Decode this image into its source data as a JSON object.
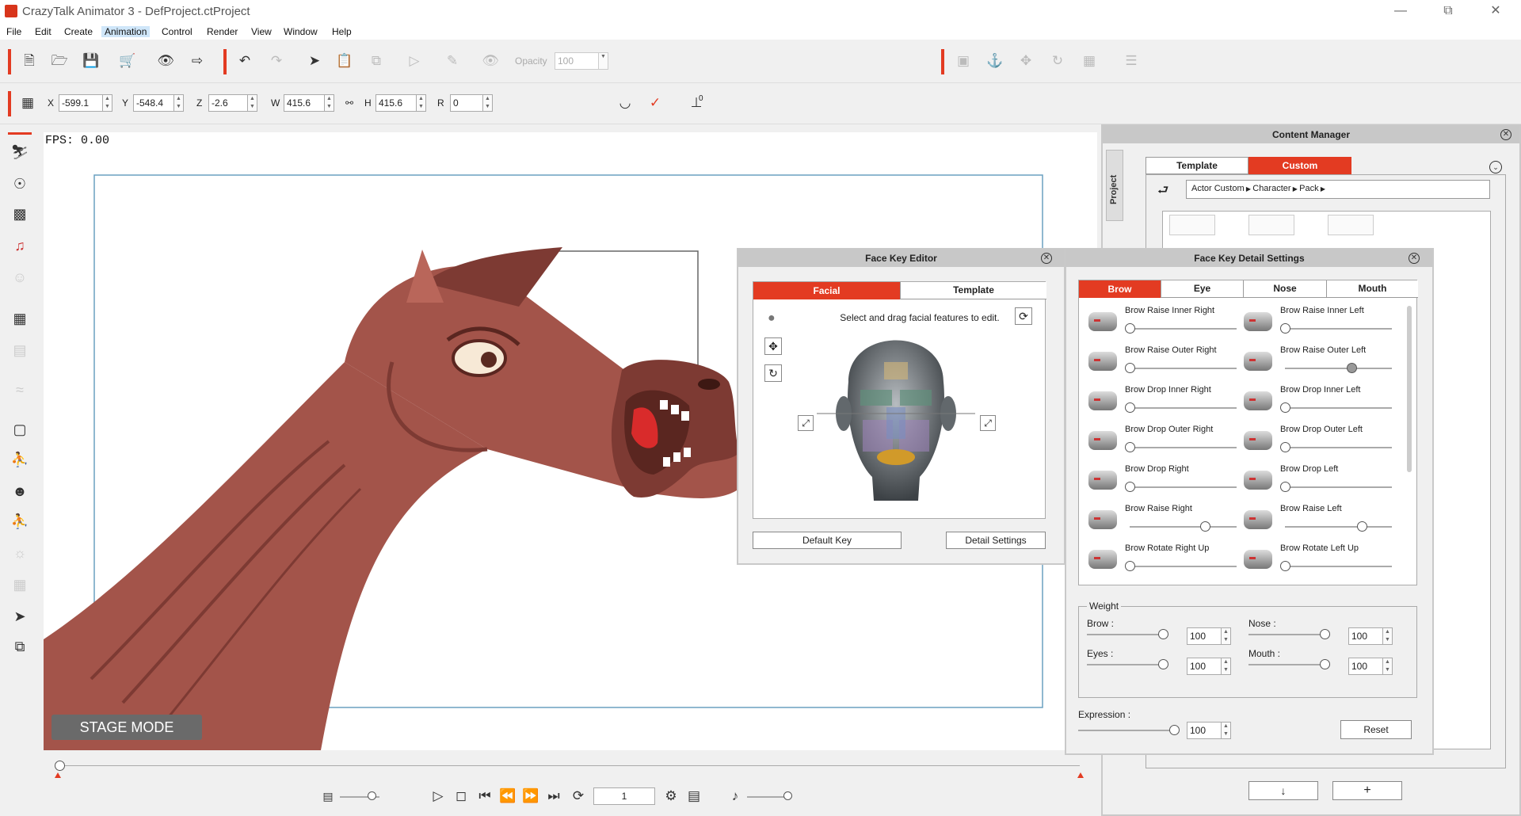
{
  "window": {
    "title": "CrazyTalk Animator 3   -  DefProject.ctProject",
    "minimize": "—",
    "maximize": "⧉",
    "close": "✕"
  },
  "menu": [
    "File",
    "Edit",
    "Create",
    "Animation",
    "Control",
    "Render",
    "View",
    "Window",
    "Help"
  ],
  "toolbar": {
    "opacity_label": "Opacity",
    "opacity_value": "100"
  },
  "transform": {
    "x_label": "X",
    "x": "-599.1",
    "y_label": "Y",
    "y": "-548.4",
    "z_label": "Z",
    "z": "-2.6",
    "w_label": "W",
    "w": "415.6",
    "h_label": "H",
    "h": "415.6",
    "r_label": "R",
    "r": "0",
    "pivot_value": "0"
  },
  "stage": {
    "fps": "FPS: 0.00",
    "mode_badge": "STAGE MODE"
  },
  "timeline": {
    "frame": "1"
  },
  "content_manager": {
    "title": "Content Manager",
    "side_tab": "Project",
    "tabs": [
      "Template",
      "Custom"
    ],
    "breadcrumb": [
      "Actor Custom",
      "Character",
      "Pack"
    ],
    "bottom_buttons": [
      "↓",
      "+"
    ]
  },
  "face_key_editor": {
    "title": "Face Key Editor",
    "tabs": [
      "Facial",
      "Template"
    ],
    "hint": "Select and drag facial features to edit.",
    "default_key": "Default Key",
    "detail_settings": "Detail Settings"
  },
  "detail": {
    "title": "Face Key Detail Settings",
    "tabs": [
      "Brow",
      "Eye",
      "Nose",
      "Mouth"
    ],
    "sliders": [
      {
        "name": "Brow Raise Inner Right",
        "value": 0
      },
      {
        "name": "Brow Raise Inner Left",
        "value": 0
      },
      {
        "name": "Brow Raise Outer Right",
        "value": 0
      },
      {
        "name": "Brow Raise Outer Left",
        "value": 0.62
      },
      {
        "name": "Brow Drop Inner Right",
        "value": 0
      },
      {
        "name": "Brow Drop Inner Left",
        "value": 0
      },
      {
        "name": "Brow Drop Outer Right",
        "value": 0
      },
      {
        "name": "Brow Drop Outer Left",
        "value": 0
      },
      {
        "name": "Brow Drop Right",
        "value": 0
      },
      {
        "name": "Brow Drop Left",
        "value": 0
      },
      {
        "name": "Brow Raise Right",
        "value": 0.7
      },
      {
        "name": "Brow Raise Left",
        "value": 0.72
      },
      {
        "name": "Brow Rotate Right Up",
        "value": 0
      },
      {
        "name": "Brow Rotate Left Up",
        "value": 0
      }
    ],
    "weight_title": "Weight",
    "weights": [
      {
        "label": "Brow :",
        "value": "100"
      },
      {
        "label": "Nose :",
        "value": "100"
      },
      {
        "label": "Eyes :",
        "value": "100"
      },
      {
        "label": "Mouth :",
        "value": "100"
      }
    ],
    "expression_label": "Expression :",
    "expression_value": "100",
    "reset": "Reset"
  },
  "colors": {
    "accent": "#e33b22",
    "horse": "#a3544a",
    "horse_dark": "#7d3a33"
  }
}
